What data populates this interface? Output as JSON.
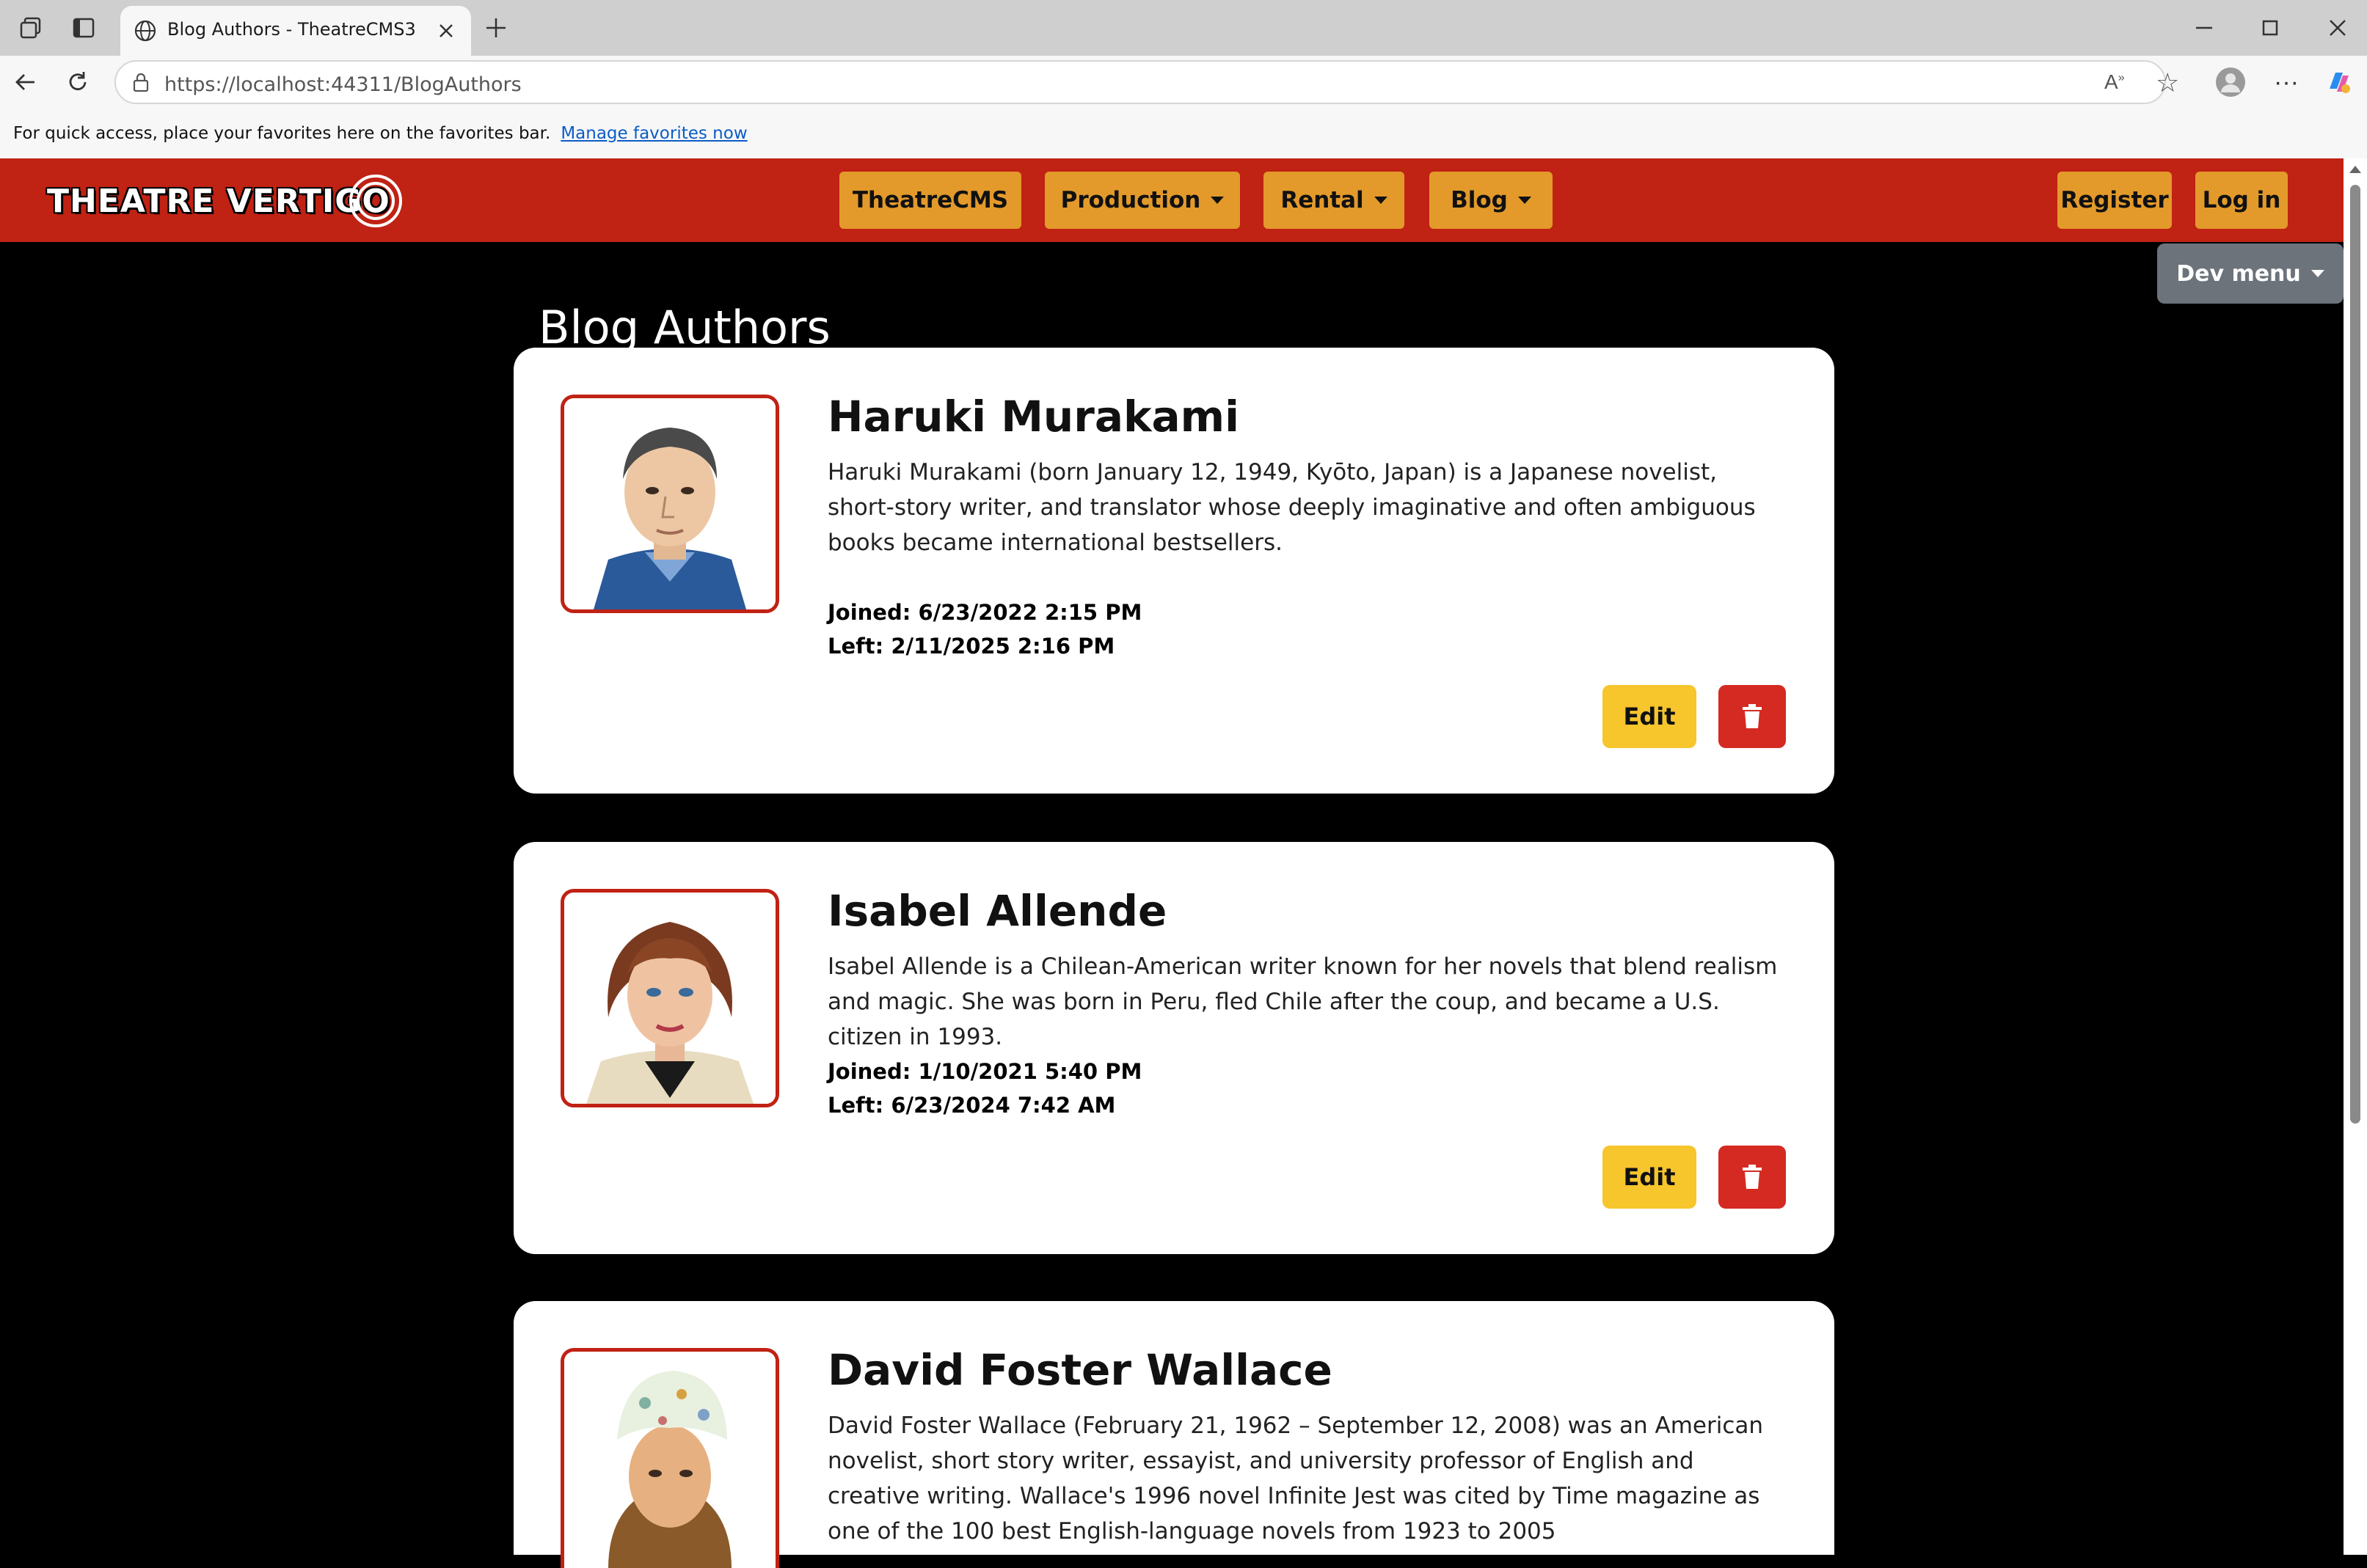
{
  "browser": {
    "tab_title": "Blog Authors - TheatreCMS3",
    "url": "https://localhost:44311/BlogAuthors",
    "favorites_text": "For quick access, place your favorites here on the favorites bar.",
    "favorites_link": "Manage favorites now"
  },
  "nav": {
    "logo": "THEATRE VERTIGO",
    "items": [
      {
        "label": "TheatreCMS",
        "dropdown": false
      },
      {
        "label": "Production",
        "dropdown": true
      },
      {
        "label": "Rental",
        "dropdown": true
      },
      {
        "label": "Blog",
        "dropdown": true
      }
    ],
    "register": "Register",
    "login": "Log in",
    "dev_menu": "Dev menu"
  },
  "page": {
    "title": "Blog Authors"
  },
  "authors": [
    {
      "name": "Haruki Murakami",
      "bio": "Haruki Murakami (born January 12, 1949, Kyōto, Japan) is a Japanese novelist, short-story writer, and translator whose deeply imaginative and often ambiguous books became international bestsellers.",
      "joined_label": "Joined:",
      "joined": "6/23/2022 2:15 PM",
      "left_label": "Left:",
      "left": "2/11/2025 2:16 PM",
      "edit": "Edit"
    },
    {
      "name": "Isabel Allende",
      "bio": "Isabel Allende is a Chilean-American writer known for her novels that blend realism and magic. She was born in Peru, fled Chile after the coup, and became a U.S. citizen in 1993.",
      "joined_label": "Joined:",
      "joined": "1/10/2021 5:40 PM",
      "left_label": "Left:",
      "left": "6/23/2024 7:42 AM",
      "edit": "Edit"
    },
    {
      "name": "David Foster Wallace",
      "bio": "David Foster Wallace (February 21, 1962 – September 12, 2008) was an American novelist, short story writer, essayist, and university professor of English and creative writing. Wallace's 1996 novel Infinite Jest was cited by Time magazine as one of the 100 best English-language novels from 1923 to 2005"
    }
  ],
  "colors": {
    "nav_red": "#c02214",
    "nav_button": "#e39a2b",
    "edit_yellow": "#f7c52c",
    "delete_red": "#d42a22"
  }
}
